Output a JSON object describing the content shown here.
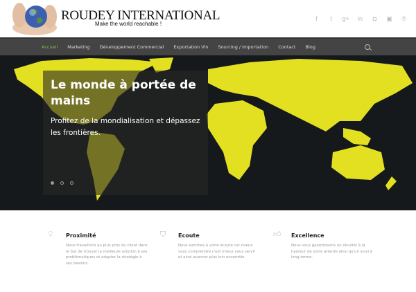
{
  "brand": {
    "name": "ROUDEY INTERNATIONAL",
    "tagline": "Make the world reachable !"
  },
  "social": [
    "facebook-icon",
    "twitter-icon",
    "google-plus-icon",
    "linkedin-icon",
    "instagram-icon",
    "youtube-icon",
    "pinterest-icon"
  ],
  "social_glyphs": [
    "f",
    "t",
    "g+",
    "in",
    "◘",
    "▣",
    "℗"
  ],
  "nav": [
    "Accueil",
    "Marketing",
    "Développement Commercial",
    "Exportation Vin",
    "Sourcing / Importation",
    "Contact",
    "Blog"
  ],
  "hero": {
    "title": "Le monde à portée de mains",
    "subtitle": "Profitez de la mondialisation et dépassez les frontières.",
    "slides": 3,
    "active_slide": 1
  },
  "features": [
    {
      "title": "Proximité",
      "icon": "lightbulb-icon",
      "text": "Nous travaillons au plus près du client dans le but de trouver la meilleure solution à ses problématiques et adapter la stratégie à ses besoins."
    },
    {
      "title": "Ecoute",
      "icon": "shield-icon",
      "text": "Nous sommes à votre écoute car mieux vous comprendre c'est mieux vous servir et ainsi avancer plus loin ensemble."
    },
    {
      "title": "Excellence",
      "icon": "thumbs-up-icon",
      "text": "Nous vous garantissons un résultat à la hauteur de votre attente ainsi qu'un suivi à long terme."
    }
  ],
  "colors": {
    "accent": "#7ac043",
    "map": "#e3e021",
    "nav": "#444444"
  }
}
